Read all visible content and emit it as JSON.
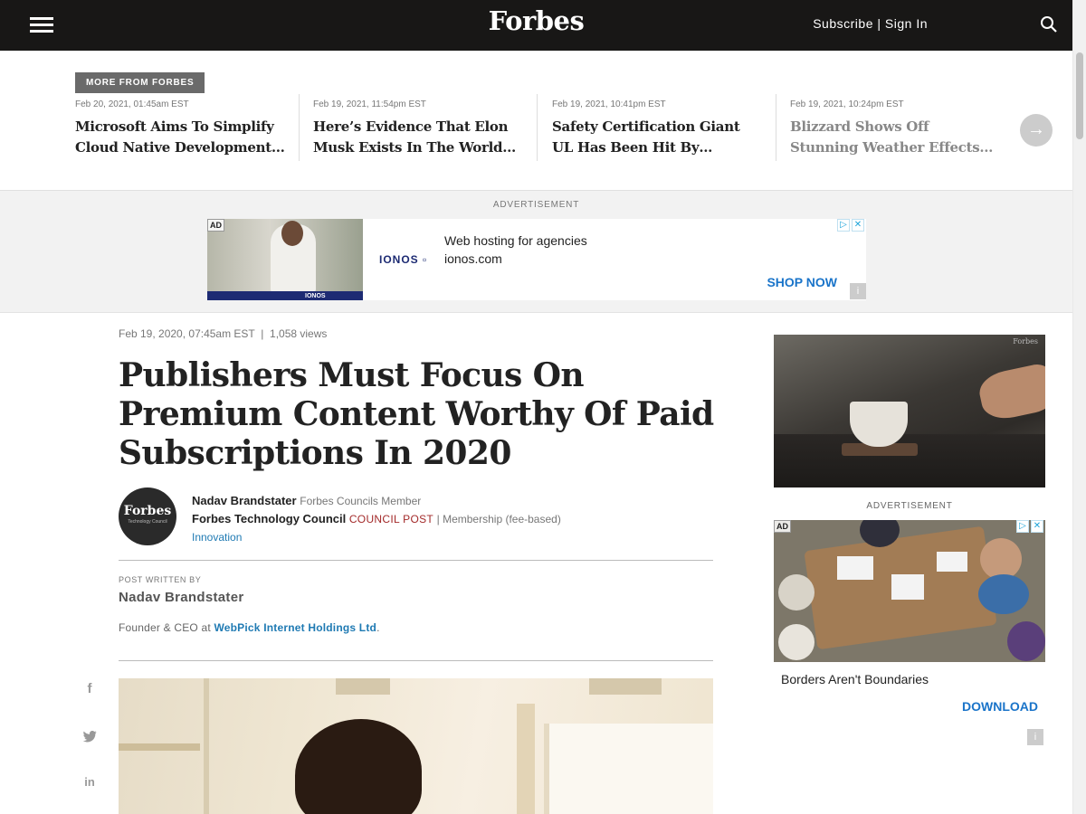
{
  "header": {
    "logo": "Forbes",
    "subscribe": "Subscribe",
    "separator": "|",
    "sign_in": "Sign In",
    "menu_icon": "hamburger-menu-icon",
    "search_icon": "search-icon",
    "bg_color": "#181716"
  },
  "more_from_forbes": {
    "label": "MORE FROM FORBES",
    "items": [
      {
        "date": "Feb 20, 2021, 01:45am EST",
        "title": "Microsoft Aims To Simplify Cloud Native Development Wit…"
      },
      {
        "date": "Feb 19, 2021, 11:54pm EST",
        "title": "Here’s Evidence That Elon Musk Exists In The World Of…"
      },
      {
        "date": "Feb 19, 2021, 10:41pm EST",
        "title": "Safety Certification Giant UL Has Been Hit By Ransomware"
      },
      {
        "date": "Feb 19, 2021, 10:24pm EST",
        "title": "Blizzard Shows Off Stunning Weather Effects For Overwatch…"
      }
    ],
    "next_icon": "arrow-right-icon",
    "next_glyph": "→"
  },
  "top_ad": {
    "label": "ADVERTISEMENT",
    "chip": "AD",
    "brand": "IONOS",
    "brand_suffix": "▫",
    "image_caption": "IONOS",
    "headline": "Web hosting for agencies",
    "url": "ionos.com",
    "cta": "SHOP NOW",
    "cta_color": "#1a74c9"
  },
  "article": {
    "meta_date": "Feb 19, 2020, 07:45am EST",
    "meta_sep": "|",
    "meta_views": "1,058 views",
    "headline": "Publishers Must Focus On Premium Content Worthy Of Paid Subscriptions In 2020",
    "avatar_text": "Forbes",
    "avatar_sub": "Technology Council",
    "author_name": "Nadav Brandstater",
    "author_role": "Forbes Councils Member",
    "council": "Forbes Technology Council",
    "council_post": "COUNCIL POST",
    "membership": "| Membership (fee-based)",
    "topic": "Innovation",
    "post_written_by": "POST WRITTEN BY",
    "writer_name": "Nadav Brandstater",
    "bio_prefix": "Founder & CEO at",
    "bio_company": "WebPick Internet Holdings Ltd",
    "bio_suffix": "."
  },
  "social": [
    {
      "name": "facebook-icon",
      "glyph": "f"
    },
    {
      "name": "twitter-icon",
      "glyph": "🐦"
    },
    {
      "name": "linkedin-icon",
      "glyph": "in"
    }
  ],
  "rail": {
    "image_watermark": "Forbes",
    "ad_label": "ADVERTISEMENT",
    "ad_chip": "AD",
    "ad_title": "Borders Aren't Boundaries",
    "ad_cta": "DOWNLOAD"
  }
}
